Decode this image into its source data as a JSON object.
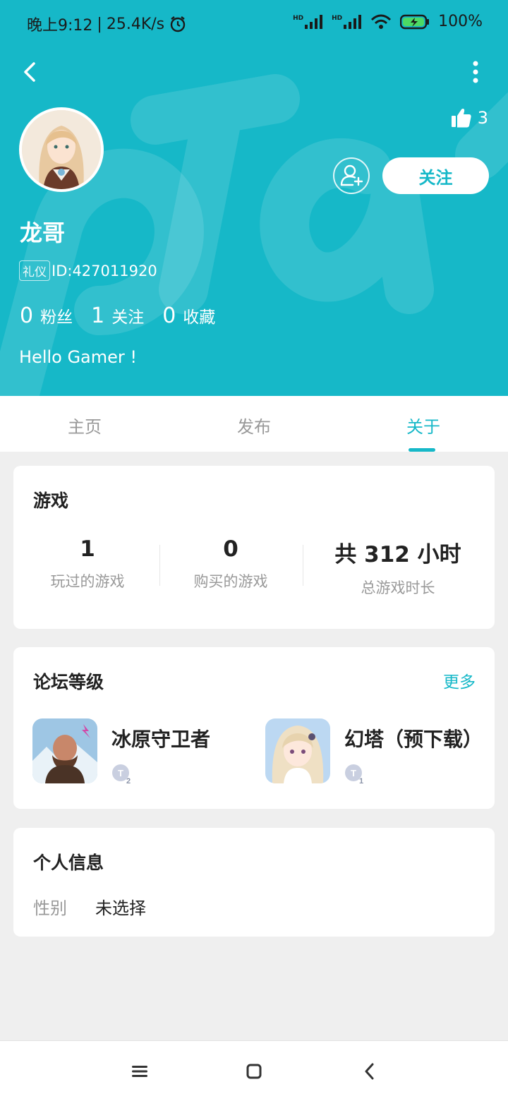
{
  "status_bar": {
    "time": "晚上9:12",
    "net_speed": "25.4K/s",
    "signal_1": "HD",
    "signal_2": "HD",
    "battery": "100%"
  },
  "header": {
    "likes_count": "3",
    "follow_label": "关注",
    "username": "龙哥",
    "tag_label": "礼仪",
    "user_id": "ID:427011920",
    "stats": [
      {
        "num": "0",
        "label": "粉丝"
      },
      {
        "num": "1",
        "label": "关注"
      },
      {
        "num": "0",
        "label": "收藏"
      }
    ],
    "bio": "Hello Gamer !",
    "theme_color": "#16b8c8"
  },
  "tabs": {
    "items": [
      {
        "label": "主页"
      },
      {
        "label": "发布"
      },
      {
        "label": "关于"
      }
    ],
    "active_index": 2
  },
  "games_card": {
    "title": "游戏",
    "stats": [
      {
        "value": "1",
        "label": "玩过的游戏"
      },
      {
        "value": "0",
        "label": "购买的游戏"
      },
      {
        "value": "共 312 小时",
        "label": "总游戏时长"
      }
    ]
  },
  "forum_card": {
    "title": "论坛等级",
    "more_label": "更多",
    "games": [
      {
        "name": "冰原守卫者",
        "level": "T2",
        "icon": "ice-guardian-game-icon"
      },
      {
        "name": "幻塔（预下载）",
        "level": "T1",
        "icon": "tower-of-fantasy-game-icon"
      }
    ]
  },
  "info_card": {
    "title": "个人信息",
    "gender_label": "性别",
    "gender_value": "未选择"
  }
}
